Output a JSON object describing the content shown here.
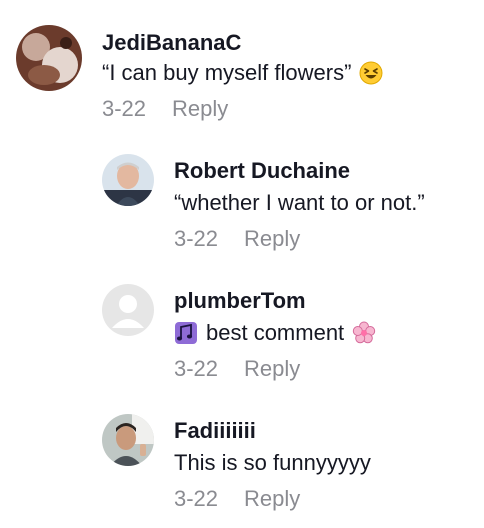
{
  "comments": [
    {
      "username": "JediBananaC",
      "text": "“I can buy myself flowers”",
      "emoji_after": "squinting-laugh-emoji",
      "date": "3-22",
      "reply_label": "Reply",
      "avatar": "dog-photo-avatar"
    },
    {
      "username": "Robert Duchaine",
      "text": "“whether I want to or not.”",
      "date": "3-22",
      "reply_label": "Reply",
      "avatar": "man-photo-avatar"
    },
    {
      "username": "plumberTom",
      "emoji_before": "music-notes-emoji",
      "text": "best comment",
      "emoji_after": "cherry-blossom-emoji",
      "date": "3-22",
      "reply_label": "Reply",
      "avatar": "default-user-avatar"
    },
    {
      "username": "Fadiiiiiii",
      "text": "This is so funnyyyyy",
      "date": "3-22",
      "reply_label": "Reply",
      "avatar": "man-photo-avatar"
    }
  ]
}
